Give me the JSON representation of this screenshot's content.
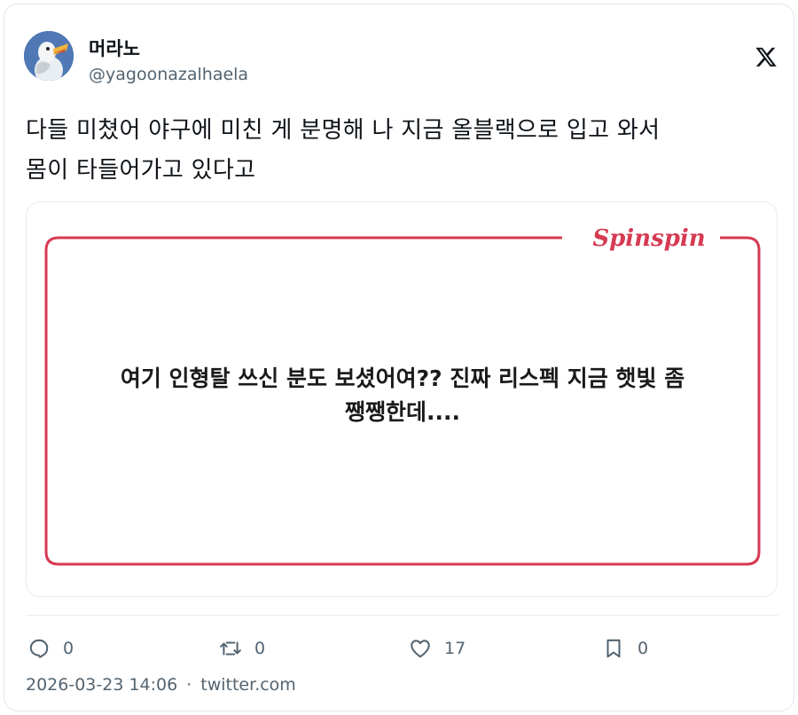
{
  "author": {
    "display_name": "머라노",
    "handle": "@yagoonazalhaela"
  },
  "platform_icon": "x-logo-icon",
  "tweet": {
    "text_line1": "다들 미쳤어 야구에 미친 게 분명해 나 지금 올블랙으로 입고 와서",
    "text_line2": "몸이 타들어가고 있다고"
  },
  "media": {
    "brand": "Spinspin",
    "quote_line1": "여기 인형탈 쓰신 분도 보셨어여?? 진짜 리스펙 지금 햇빛 좀",
    "quote_line2": "쨍쨍한데....",
    "frame_color": "#d63a52"
  },
  "actions": {
    "reply_count": "0",
    "retweet_count": "0",
    "like_count": "17",
    "bookmark_count": "0"
  },
  "meta": {
    "timestamp": "2026-03-23 14:06",
    "separator": "·",
    "source": "twitter.com"
  }
}
